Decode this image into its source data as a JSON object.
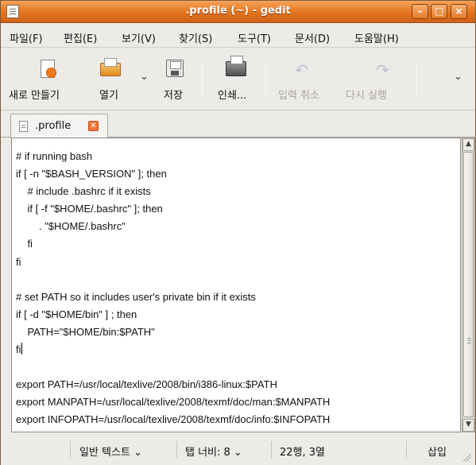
{
  "window": {
    "title": ".profile (~) - gedit",
    "minimize": "–",
    "maximize": "□",
    "close": "×"
  },
  "menu": [
    "파일(F)",
    "편집(E)",
    "보기(V)",
    "찾기(S)",
    "도구(T)",
    "문서(D)",
    "도움말(H)"
  ],
  "toolbar": {
    "new_label": "새로 만들기",
    "open_label": "열기",
    "save_label": "저장",
    "print_label": "인쇄...",
    "undo_label": "입력 취소",
    "redo_label": "다시 실행",
    "open_dropdown": "⌄",
    "overflow": "⌄"
  },
  "tab": {
    "label": ".profile",
    "close": "✕"
  },
  "editor": {
    "lines": [
      "# if running bash",
      "if [ -n \"$BASH_VERSION\" ]; then",
      "    # include .bashrc if it exists",
      "    if [ -f \"$HOME/.bashrc\" ]; then",
      "        . \"$HOME/.bashrc\"",
      "    fi",
      "fi",
      "",
      "# set PATH so it includes user's private bin if it exists",
      "if [ -d \"$HOME/bin\" ] ; then",
      "    PATH=\"$HOME/bin:$PATH\"",
      "fi",
      "",
      "export PATH=/usr/local/texlive/2008/bin/i386-linux:$PATH",
      "export MANPATH=/usr/local/texlive/2008/texmf/doc/man:$MANPATH",
      "export INFOPATH=/usr/local/texlive/2008/texmf/doc/info:$INFOPATH"
    ]
  },
  "statusbar": {
    "language": "일반 텍스트 ⌄",
    "tab_width": "탭 너비:  8 ⌄",
    "position": "22행, 3열",
    "mode": "삽입"
  },
  "colors": {
    "titlebar": "#e2731e",
    "tab_close": "#f0773a",
    "new_icon_accent": "#f27a1c"
  }
}
